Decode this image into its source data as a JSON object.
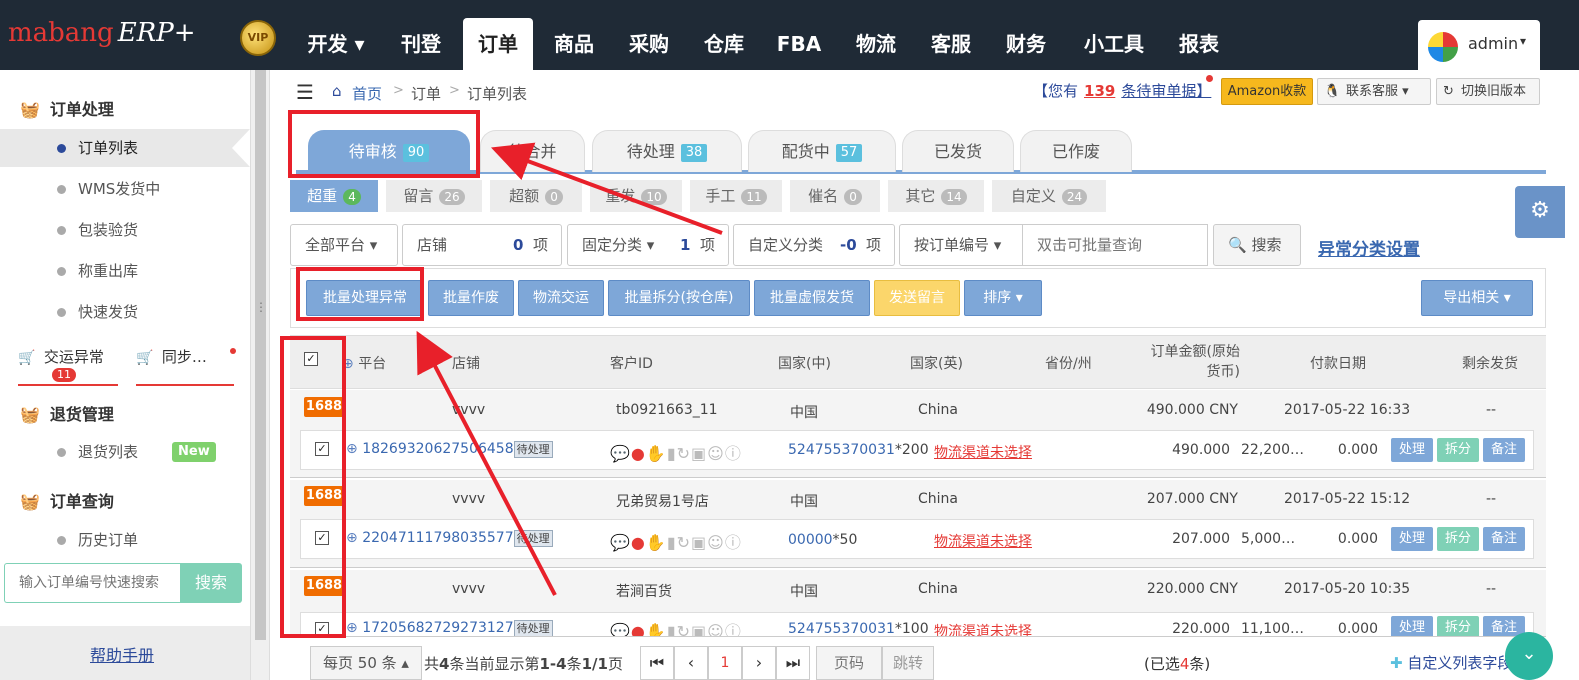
{
  "topnav": {
    "logo_main": "mabang",
    "logo_erp": "ERP+",
    "vip": "VIP",
    "items": [
      {
        "label": "开发 ▾"
      },
      {
        "label": "刊登"
      },
      {
        "label": "订单"
      },
      {
        "label": "商品"
      },
      {
        "label": "采购"
      },
      {
        "label": "仓库"
      },
      {
        "label": "FBA"
      },
      {
        "label": "物流"
      },
      {
        "label": "客服"
      },
      {
        "label": "财务"
      },
      {
        "label": "小工具"
      },
      {
        "label": "报表"
      }
    ],
    "active": "订单",
    "user": "admin"
  },
  "sidebar": {
    "sections": {
      "order_processing": "订单处理",
      "return_mgmt": "退货管理",
      "order_query": "订单查询"
    },
    "items": [
      "订单列表",
      "WMS发货中",
      "包装验货",
      "称重出库",
      "快速发货"
    ],
    "ship_exception": "交运异常",
    "ship_exception_count": "11",
    "sync": "同步…",
    "return_list": "退货列表",
    "new_badge": "New",
    "history": "历史订单",
    "search_placeholder": "输入订单编号快速搜索",
    "search_btn": "搜索",
    "help": "帮助手册"
  },
  "breadcrumb": {
    "home": "首页",
    "orders": "订单",
    "list": "订单列表"
  },
  "notice": {
    "prefix": "【您有",
    "count": "139",
    "suffix": "条待审单据】"
  },
  "header_buttons": {
    "amazon": "Amazon收款",
    "support": "联系客服 ▾",
    "switch": "切换旧版本"
  },
  "tabs": [
    {
      "label": "待审核",
      "count": "90"
    },
    {
      "label": "待合并",
      "count": ""
    },
    {
      "label": "待处理",
      "count": "38"
    },
    {
      "label": "配货中",
      "count": "57"
    },
    {
      "label": "已发货",
      "count": ""
    },
    {
      "label": "已作废",
      "count": ""
    }
  ],
  "subtabs": [
    {
      "label": "超重",
      "count": "4"
    },
    {
      "label": "留言",
      "count": "26"
    },
    {
      "label": "超额",
      "count": "0"
    },
    {
      "label": "重发",
      "count": "10"
    },
    {
      "label": "手工",
      "count": "11"
    },
    {
      "label": "催名",
      "count": "0"
    },
    {
      "label": "其它",
      "count": "14"
    },
    {
      "label": "自定义",
      "count": "24"
    }
  ],
  "filters": {
    "platform": "全部平台 ▾",
    "shop_label": "店铺",
    "shop_count": "0",
    "shop_unit": "项",
    "fixed_label": "固定分类 ▾",
    "fixed_count": "1",
    "fixed_unit": "项",
    "custom_label": "自定义分类",
    "custom_count": "-0",
    "custom_unit": "项",
    "order_no": "按订单编号 ▾",
    "search_placeholder": "双击可批量查询",
    "search_btn": "搜索",
    "exception_link": "异常分类设置"
  },
  "actions": {
    "batch_exception": "批量处理异常",
    "batch_void": "批量作废",
    "ship": "物流交运",
    "split": "批量拆分(按仓库)",
    "fake": "批量虚假发货",
    "message": "发送留言",
    "sort": "排序 ▾",
    "export": "导出相关 ▾"
  },
  "table_header": {
    "platform": "平台",
    "shop": "店铺",
    "customer": "客户ID",
    "country_cn": "国家(中)",
    "country_en": "国家(英)",
    "province": "省份/州",
    "amount": "订单金额(原始货币)",
    "paydate": "付款日期",
    "remaining": "剩余发货"
  },
  "orders": [
    {
      "platform": "1688",
      "shop": "vvvv",
      "customer": "tb0921663_11",
      "country_cn": "中国",
      "country_en": "China",
      "amount": "490.000 CNY",
      "paydate": "2017-05-22 16:33",
      "remaining": "--",
      "order_no": "18269320627506458",
      "status": "待处理",
      "sku": "524755370031",
      "qty": "*200",
      "logistics": "物流渠道未选择",
      "amt": "490.000",
      "c2": "22,200…",
      "c3": "0.000"
    },
    {
      "platform": "1688",
      "shop": "vvvv",
      "customer": "兄弟贸易1号店",
      "country_cn": "中国",
      "country_en": "China",
      "amount": "207.000 CNY",
      "paydate": "2017-05-22 15:12",
      "remaining": "--",
      "order_no": "22047111798035577",
      "status": "待处理",
      "sku": "00000",
      "qty": "*50",
      "logistics": "物流渠道未选择",
      "amt": "207.000",
      "c2": "5,000…",
      "c3": "0.000"
    },
    {
      "platform": "1688",
      "shop": "vvvv",
      "customer": "若涧百货",
      "country_cn": "中国",
      "country_en": "China",
      "amount": "220.000 CNY",
      "paydate": "2017-05-20 10:35",
      "remaining": "--",
      "order_no": "17205682729273127",
      "status": "待处理",
      "sku": "524755370031",
      "qty": "*100",
      "logistics": "物流渠道未选择",
      "amt": "220.000",
      "c2": "11,100…",
      "c3": "0.000"
    }
  ],
  "row_buttons": {
    "process": "处理",
    "split": "拆分",
    "note": "备注"
  },
  "pagination": {
    "per_page": "每页 50 条 ▴",
    "total_a": "共",
    "total_n": "4",
    "total_b": "条当前显示第",
    "range": "1-4",
    "total_c": "条",
    "pages": "1/1",
    "total_d": "页",
    "current": "1",
    "page_input": "页码",
    "jump": "跳转",
    "selected_a": "(已选",
    "selected_n": "4",
    "selected_b": "条)",
    "custom_fields": "自定义列表字段"
  }
}
